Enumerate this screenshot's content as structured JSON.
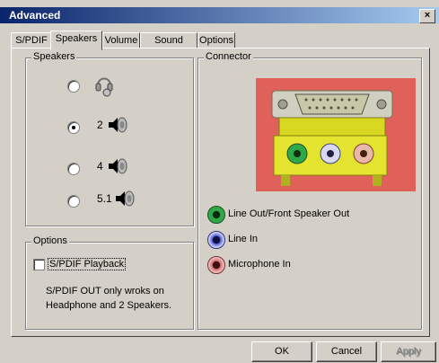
{
  "window": {
    "title": "Advanced",
    "close_glyph": "×"
  },
  "tabs": [
    {
      "label": "S/PDIF"
    },
    {
      "label": "Speakers"
    },
    {
      "label": "Volume"
    },
    {
      "label": "Sound Effect"
    },
    {
      "label": "Options"
    }
  ],
  "speakers": {
    "legend": "Speakers",
    "options": [
      {
        "label": "",
        "icon": "headphone-icon"
      },
      {
        "label": "2",
        "icon": "speaker-icon"
      },
      {
        "label": "4",
        "icon": "speaker-icon"
      },
      {
        "label": "5.1",
        "icon": "speaker-icon"
      }
    ],
    "selected_index": 1
  },
  "options": {
    "legend": "Options",
    "checkbox_label": "S/PDIF Playback",
    "checked": false,
    "note_line1": "S/PDIF OUT only wroks on",
    "note_line2": "Headphone and 2 Speakers."
  },
  "connector": {
    "legend": "Connector",
    "jacks": [
      {
        "label": "Line Out/Front Speaker Out",
        "color": "#2fa84a"
      },
      {
        "label": "Line In",
        "color": "#4b5bd6"
      },
      {
        "label": "Microphone In",
        "color": "#d46a6a"
      }
    ]
  },
  "buttons": {
    "ok": "OK",
    "cancel": "Cancel",
    "apply": "Apply"
  }
}
